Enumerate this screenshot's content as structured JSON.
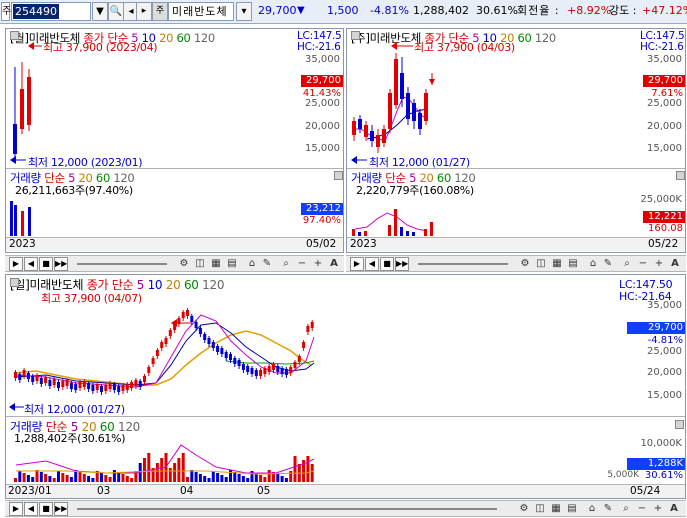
{
  "toolbar": {
    "market": "주",
    "code": "254490",
    "stock_name_chip": "주",
    "stock_name": "미래반도체",
    "price": "29,700",
    "change_arrow": "▼",
    "change": "1,500",
    "change_pct": "-4.81%",
    "volume": "1,288,402",
    "vol_ratio": "30.61%",
    "turnover_label": "회전율 :",
    "turnover": "+8.92%",
    "strength_label": "강도 :",
    "strength": "+47.12%"
  },
  "panes": {
    "monthly": {
      "title": "[월]미래반도체",
      "ma_label": "종가 단순",
      "ma_periods": [
        "5",
        "10",
        "20",
        "60",
        "120"
      ],
      "lc": "LC:147.5",
      "hc": "HC:-21.6",
      "high_note": "최고 37,900 (2023/04)",
      "low_note": "최저 12,000 (2023/01)",
      "yticks": [
        "35,000",
        "30,000",
        "25,000",
        "20,000",
        "15,000"
      ],
      "price_badge": "29,700",
      "price_pct": "41.43%",
      "vol_title": "거래량",
      "vol_ma_label": "단순",
      "vol_ma_periods": [
        "5",
        "20",
        "60",
        "120"
      ],
      "vol_note": "26,211,663주(97.40%)",
      "vol_badge": "23,212",
      "vol_pct": "97.40%",
      "date_left": "2023",
      "date_right": "05/02"
    },
    "weekly": {
      "title": "[주]미래반도체",
      "ma_label": "종가 단순",
      "ma_periods": [
        "5",
        "10",
        "20",
        "60",
        "120"
      ],
      "lc": "LC:147.5",
      "hc": "HC:-21.6",
      "high_note": "최고 37,900 (04/03)",
      "low_note": "최저 12,000 (01/27)",
      "yticks": [
        "35,000",
        "30,000",
        "25,000",
        "20,000",
        "15,000"
      ],
      "price_badge": "29,700",
      "price_pct": "7.61%",
      "vol_title": "거래량",
      "vol_ma_label": "단순",
      "vol_ma_periods": [
        "5",
        "20",
        "60",
        "120"
      ],
      "vol_note": "2,220,779주(160.08%)",
      "vol_tick": "25,000K",
      "vol_badge": "12,221",
      "vol_pct": "160.08",
      "date_left": "2023",
      "date_right": "05/22"
    },
    "daily": {
      "title": "[일]미래반도체",
      "ma_label": "종가 단순",
      "ma_periods": [
        "5",
        "10",
        "20",
        "60",
        "120"
      ],
      "lc": "LC:147.50",
      "hc": "HC:-21.64",
      "high_note": "최고 37,900 (04/07)",
      "low_note": "최저 12,000 (01/27)",
      "yticks": [
        "35,000",
        "30,000",
        "25,000",
        "20,000",
        "15,000"
      ],
      "price_badge": "29,700",
      "price_pct": "-4.81%",
      "vol_title": "거래량",
      "vol_ma_label": "단순",
      "vol_ma_periods": [
        "5",
        "20",
        "60",
        "120"
      ],
      "vol_note": "1,288,402주(30.61%)",
      "vol_tick": "10,000K",
      "vol_tick2": "5,000K",
      "vol_badge": "1,288K",
      "vol_pct": "30.61%",
      "dates": [
        "2023/01",
        "03",
        "04",
        "05",
        "05/24"
      ]
    }
  },
  "colors": {
    "up": "#e00000",
    "down": "#0000d0",
    "ma5": "#d000d0",
    "ma10": "#0000a0",
    "ma20": "#e0a000",
    "ma60": "#00a000",
    "ma120": "#777777",
    "badge_red": "#e00000",
    "badge_blue": "#1040ff"
  }
}
